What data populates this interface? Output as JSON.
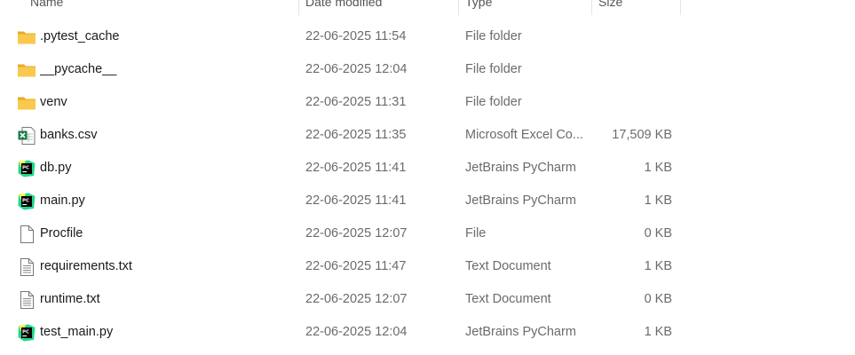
{
  "columns": {
    "name": "Name",
    "date_modified": "Date modified",
    "type": "Type",
    "size": "Size"
  },
  "files": [
    {
      "name": ".pytest_cache",
      "date": "22-06-2025 11:54",
      "type": "File folder",
      "size": "",
      "icon": "folder-icon"
    },
    {
      "name": "__pycache__",
      "date": "22-06-2025 12:04",
      "type": "File folder",
      "size": "",
      "icon": "folder-icon"
    },
    {
      "name": "venv",
      "date": "22-06-2025 11:31",
      "type": "File folder",
      "size": "",
      "icon": "folder-icon"
    },
    {
      "name": "banks.csv",
      "date": "22-06-2025 11:35",
      "type": "Microsoft Excel Co...",
      "size": "17,509 KB",
      "icon": "excel-csv-icon"
    },
    {
      "name": "db.py",
      "date": "22-06-2025 11:41",
      "type": "JetBrains PyCharm",
      "size": "1 KB",
      "icon": "pycharm-icon"
    },
    {
      "name": "main.py",
      "date": "22-06-2025 11:41",
      "type": "JetBrains PyCharm",
      "size": "1 KB",
      "icon": "pycharm-icon"
    },
    {
      "name": "Procfile",
      "date": "22-06-2025 12:07",
      "type": "File",
      "size": "0 KB",
      "icon": "blank-file-icon"
    },
    {
      "name": "requirements.txt",
      "date": "22-06-2025 11:47",
      "type": "Text Document",
      "size": "1 KB",
      "icon": "text-file-icon"
    },
    {
      "name": "runtime.txt",
      "date": "22-06-2025 12:07",
      "type": "Text Document",
      "size": "0 KB",
      "icon": "text-file-icon"
    },
    {
      "name": "test_main.py",
      "date": "22-06-2025 12:04",
      "type": "JetBrains PyCharm",
      "size": "1 KB",
      "icon": "pycharm-icon"
    }
  ],
  "colors": {
    "folder": "#f8c94c",
    "excel": "#1d7a45",
    "pycharm": "#21d789"
  }
}
